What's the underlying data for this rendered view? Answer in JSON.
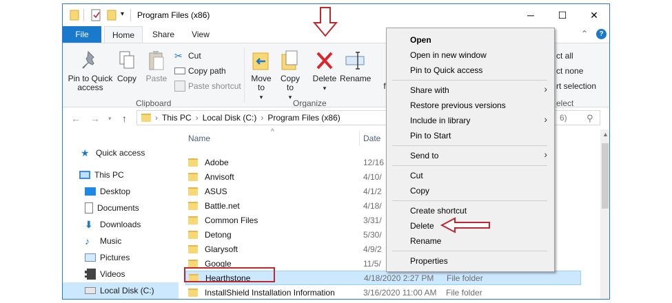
{
  "window": {
    "title": "Program Files (x86)"
  },
  "ribbon_tabs": {
    "file": "File",
    "home": "Home",
    "share": "Share",
    "view": "View"
  },
  "clipboard": {
    "pin": "Pin to Quick access",
    "copy": "Copy",
    "paste": "Paste",
    "cut": "Cut",
    "copy_path": "Copy path",
    "paste_shortcut": "Paste shortcut",
    "group": "Clipboard"
  },
  "organize": {
    "move_to": "Move to",
    "copy_to": "Copy to",
    "delete": "Delete",
    "rename": "Rename",
    "new_partial": "f",
    "group": "Organize"
  },
  "select": {
    "select_all": "ct all",
    "select_none": "ct none",
    "invert": "rt selection",
    "group": "elect"
  },
  "address": {
    "crumbs": [
      "This PC",
      "Local Disk (C:)",
      "Program Files (x86)"
    ],
    "search_partial": "6)"
  },
  "nav": {
    "quick_access": "Quick access",
    "this_pc": "This PC",
    "desktop": "Desktop",
    "documents": "Documents",
    "downloads": "Downloads",
    "music": "Music",
    "pictures": "Pictures",
    "videos": "Videos",
    "local_disk": "Local Disk (C:)"
  },
  "columns": {
    "name": "Name",
    "date": "Date"
  },
  "files": [
    {
      "name": "Adobe",
      "date": "12/16",
      "type": ""
    },
    {
      "name": "Anvisoft",
      "date": "4/10/",
      "type": ""
    },
    {
      "name": "ASUS",
      "date": "4/1/2",
      "type": ""
    },
    {
      "name": "Battle.net",
      "date": "4/18/",
      "type": ""
    },
    {
      "name": "Common Files",
      "date": "3/31/",
      "type": ""
    },
    {
      "name": "Detong",
      "date": "5/30/",
      "type": ""
    },
    {
      "name": "Glarysoft",
      "date": "4/9/2",
      "type": ""
    },
    {
      "name": "Google",
      "date": "11/5/",
      "type": ""
    },
    {
      "name": "Hearthstone",
      "date": "4/18/2020 2:27 PM",
      "type": "File folder"
    },
    {
      "name": "InstallShield Installation Information",
      "date": "3/16/2020 11:00 AM",
      "type": "File folder"
    }
  ],
  "context_menu": {
    "open": "Open",
    "open_new_window": "Open in new window",
    "pin_quick": "Pin to Quick access",
    "share_with": "Share with",
    "restore": "Restore previous versions",
    "include_library": "Include in library",
    "pin_start": "Pin to Start",
    "send_to": "Send to",
    "cut": "Cut",
    "copy": "Copy",
    "create_shortcut": "Create shortcut",
    "delete": "Delete",
    "rename": "Rename",
    "properties": "Properties"
  },
  "colors": {
    "accent": "#1979ca",
    "selection": "#cce8ff",
    "annotation": "#c0262e",
    "delete_red": "#d9262c"
  }
}
